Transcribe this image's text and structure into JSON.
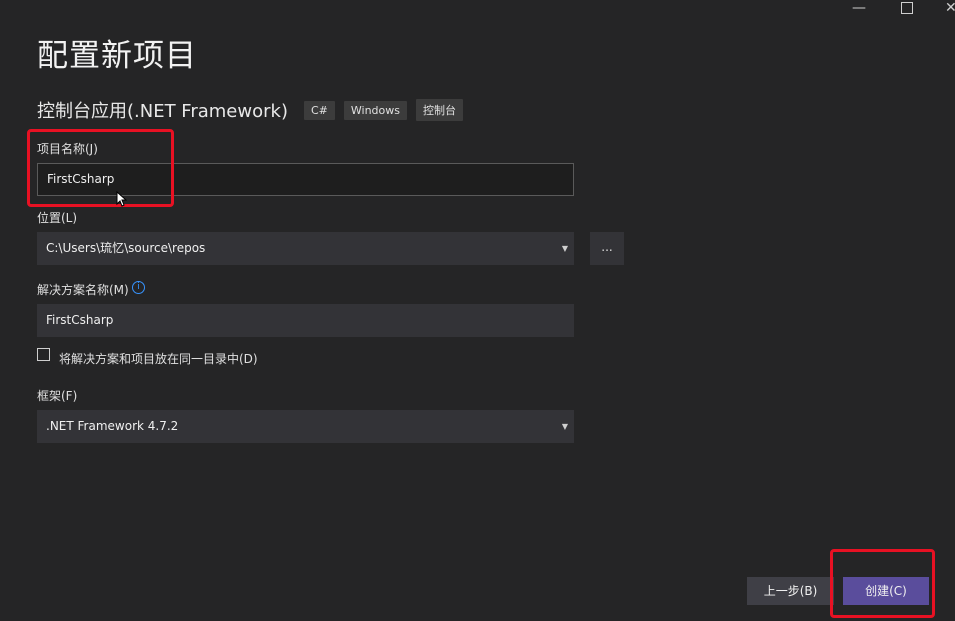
{
  "window": {
    "minimize_glyph": "—",
    "close_glyph": "✕"
  },
  "header": {
    "title": "配置新项目",
    "subtitle": "控制台应用(.NET Framework)",
    "tags": [
      "C#",
      "Windows",
      "控制台"
    ]
  },
  "form": {
    "project_name": {
      "label": "项目名称(J)",
      "value": "FirstCsharp"
    },
    "location": {
      "label": "位置(L)",
      "value": "C:\\Users\\琉忆\\source\\repos",
      "browse_label": "..."
    },
    "solution_name": {
      "label": "解决方案名称(M)",
      "value": "FirstCsharp",
      "info_glyph": "i"
    },
    "same_directory": {
      "label": "将解决方案和项目放在同一目录中(D)",
      "checked": false
    },
    "framework": {
      "label": "框架(F)",
      "value": ".NET Framework 4.7.2"
    }
  },
  "footer": {
    "back_label": "上一步(B)",
    "create_label": "创建(C)"
  },
  "colors": {
    "highlight": "#e81123",
    "primary": "#5a4d9c",
    "info": "#3794ff"
  },
  "icons": [
    "minimize-icon",
    "maximize-icon",
    "close-icon",
    "dropdown-caret-icon",
    "info-icon",
    "mouse-cursor-icon"
  ]
}
